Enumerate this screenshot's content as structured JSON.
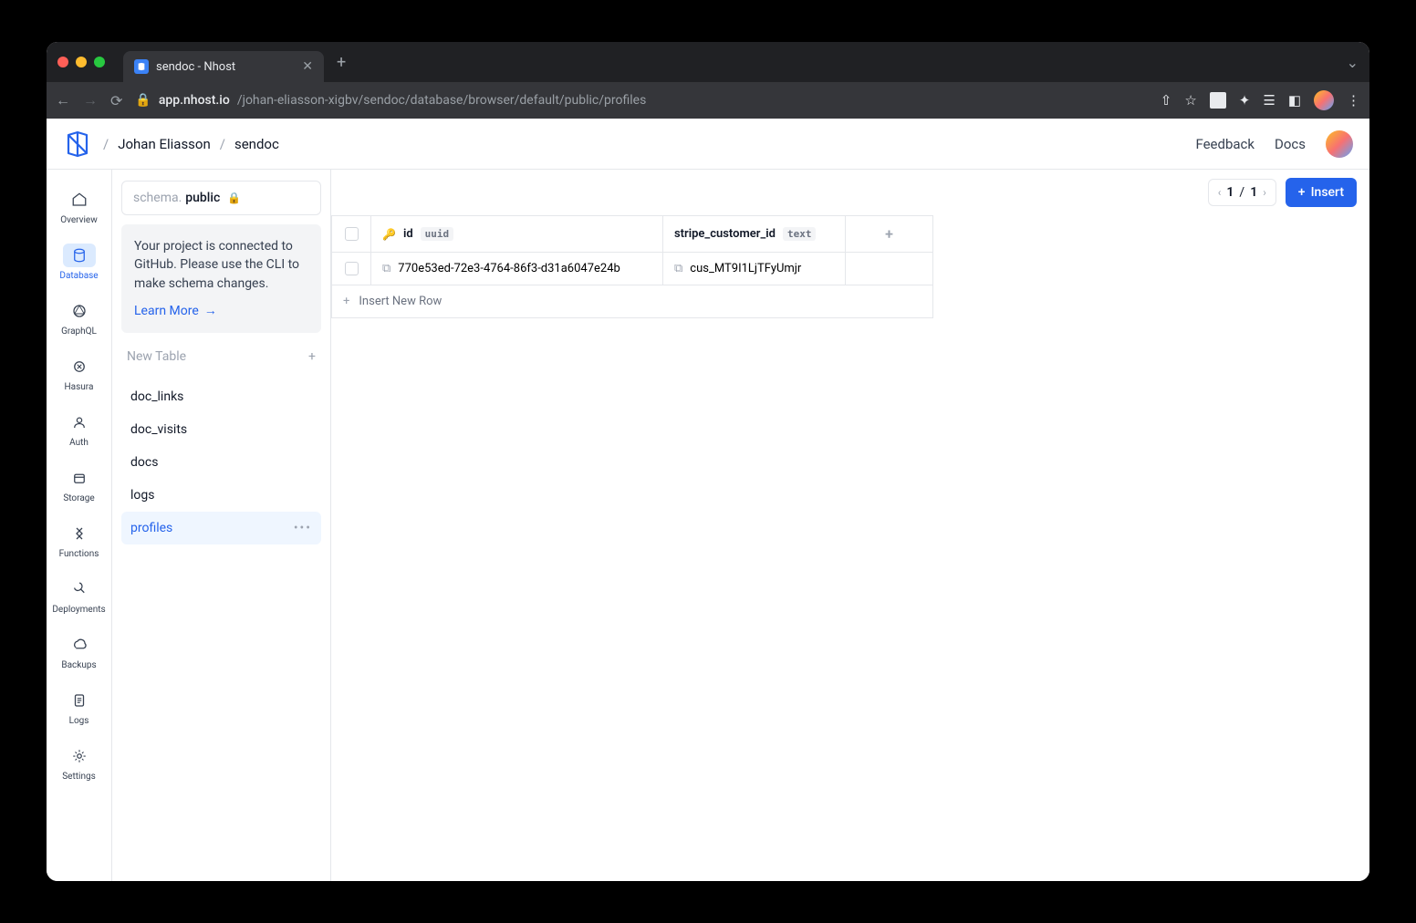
{
  "browser": {
    "tab_title": "sendoc - Nhost",
    "url_host": "app.nhost.io",
    "url_path": "/johan-eliasson-xigbv/sendoc/database/browser/default/public/profiles"
  },
  "header": {
    "breadcrumb_owner": "Johan Eliasson",
    "breadcrumb_project": "sendoc",
    "feedback": "Feedback",
    "docs": "Docs"
  },
  "leftnav": [
    {
      "key": "overview",
      "label": "Overview"
    },
    {
      "key": "database",
      "label": "Database"
    },
    {
      "key": "graphql",
      "label": "GraphQL"
    },
    {
      "key": "hasura",
      "label": "Hasura"
    },
    {
      "key": "auth",
      "label": "Auth"
    },
    {
      "key": "storage",
      "label": "Storage"
    },
    {
      "key": "functions",
      "label": "Functions"
    },
    {
      "key": "deployments",
      "label": "Deployments"
    },
    {
      "key": "backups",
      "label": "Backups"
    },
    {
      "key": "logs",
      "label": "Logs"
    },
    {
      "key": "settings",
      "label": "Settings"
    }
  ],
  "sidebar": {
    "schema_prefix": "schema.",
    "schema_name": "public",
    "info_text": "Your project is connected to GitHub. Please use the CLI to make schema changes.",
    "learn_more": "Learn More",
    "new_table": "New Table",
    "tables": [
      "doc_links",
      "doc_visits",
      "docs",
      "logs",
      "profiles"
    ],
    "active_table": "profiles"
  },
  "main": {
    "page_current": "1",
    "page_total": "1",
    "insert_label": "Insert",
    "columns": [
      {
        "name": "id",
        "type": "uuid",
        "pk": true
      },
      {
        "name": "stripe_customer_id",
        "type": "text",
        "pk": false
      }
    ],
    "rows": [
      {
        "id": "770e53ed-72e3-4764-86f3-d31a6047e24b",
        "stripe_customer_id": "cus_MT9I1LjTFyUmjr"
      }
    ],
    "insert_row_label": "Insert New Row"
  }
}
